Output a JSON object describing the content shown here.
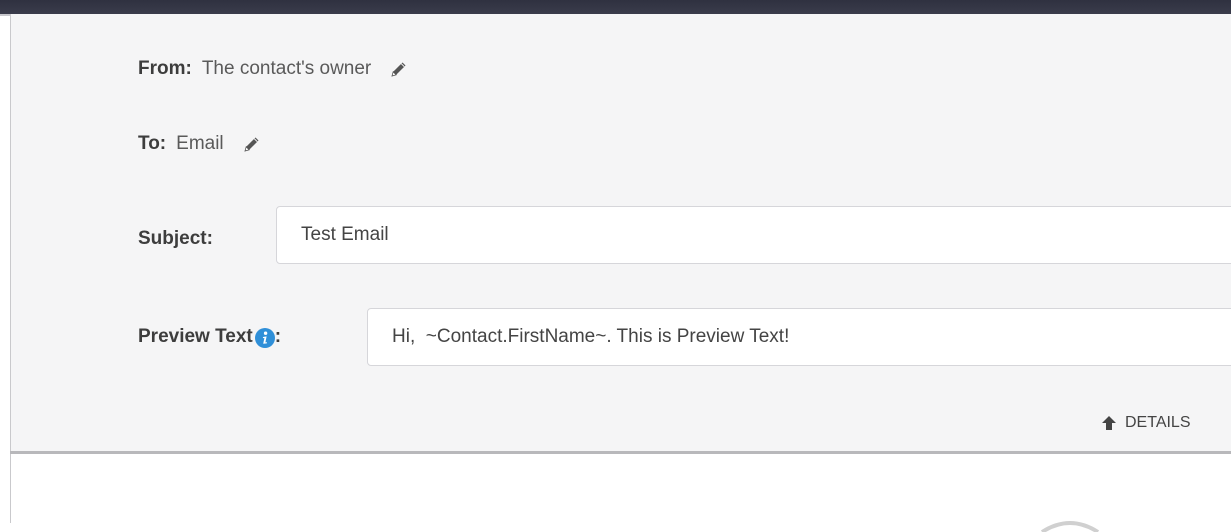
{
  "from": {
    "label": "From:",
    "value": "The contact's owner",
    "edit_icon": "pencil-icon"
  },
  "to": {
    "label": "To:",
    "value": "Email",
    "edit_icon": "pencil-icon"
  },
  "subject": {
    "label": "Subject:",
    "value": "Test Email"
  },
  "preview_text": {
    "label": "Preview Text",
    "label_suffix": ":",
    "value": "Hi,  ~Contact.FirstName~. This is Preview Text!",
    "info_icon": "info-icon"
  },
  "details_toggle": {
    "label": "DETAILS",
    "icon": "arrow-up-icon"
  },
  "colors": {
    "top_bar": "#2f3140",
    "panel_background": "#f5f5f6",
    "info_icon": "#2f8fd8"
  }
}
